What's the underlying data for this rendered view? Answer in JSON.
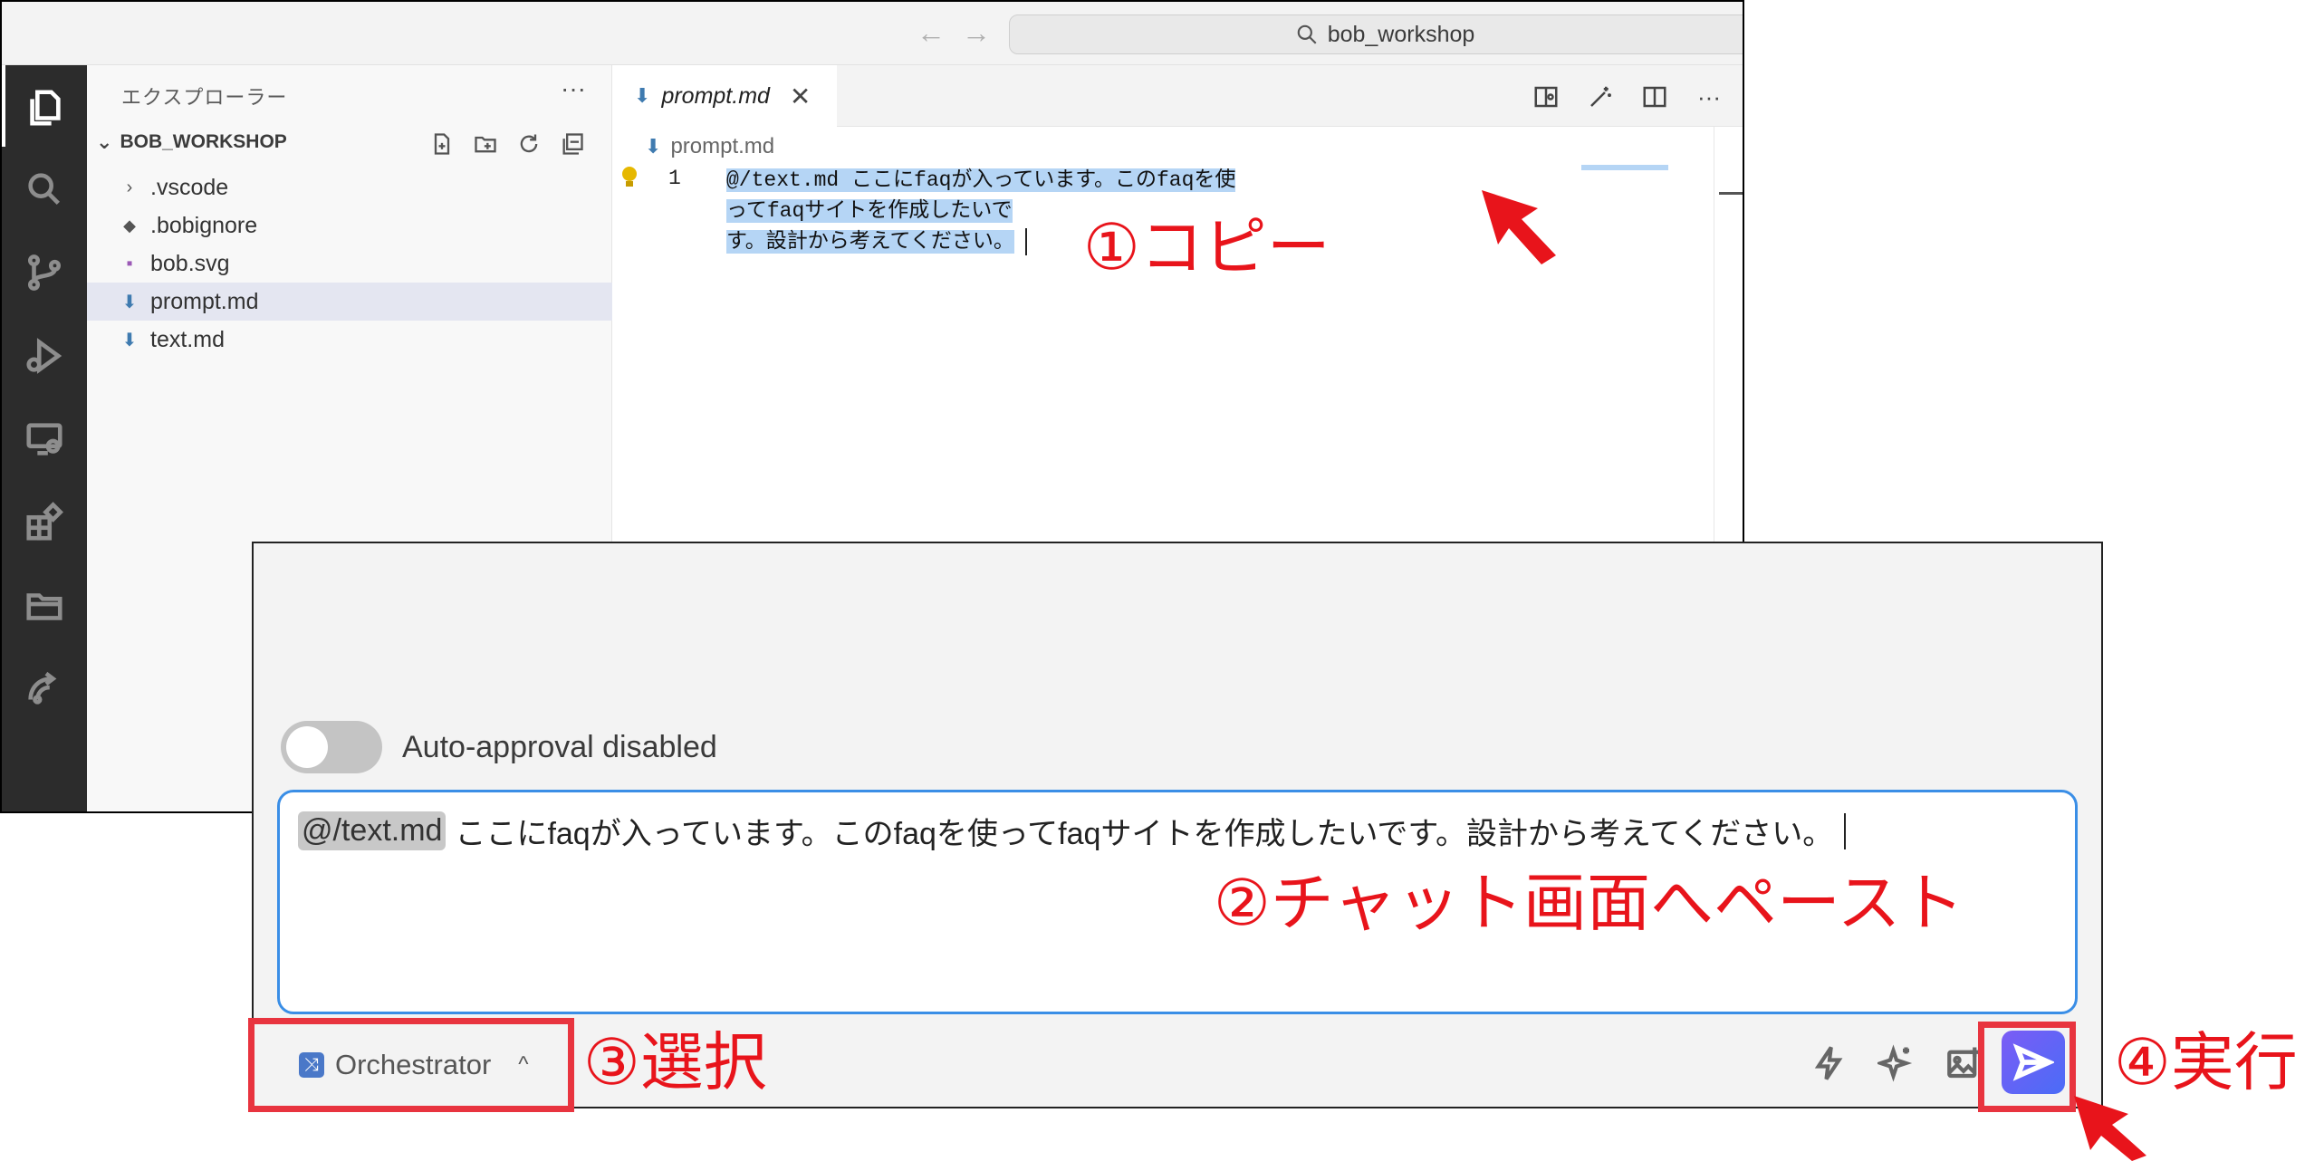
{
  "titlebar": {
    "search_text": "bob_workshop",
    "back_icon": "←",
    "forward_icon": "→"
  },
  "activitybar": {
    "items": [
      "explorer-icon",
      "search-icon",
      "source-control-icon",
      "run-debug-icon",
      "remote-explorer-icon",
      "extensions-icon",
      "folder-icon",
      "bob-icon"
    ]
  },
  "sidebar": {
    "title": "エクスプローラー",
    "more": "···",
    "root": "BOB_WORKSHOP",
    "items": [
      {
        "label": ".vscode",
        "icon": "›"
      },
      {
        "label": ".bobignore",
        "icon": "◆"
      },
      {
        "label": "bob.svg",
        "icon": "▪"
      },
      {
        "label": "prompt.md",
        "icon": "⬇"
      },
      {
        "label": "text.md",
        "icon": "⬇"
      }
    ]
  },
  "editor": {
    "tab_label": "prompt.md",
    "tab_close": "✕",
    "more": "···",
    "breadcrumb": "prompt.md",
    "line_number": "1",
    "code_line1": "@/text.md ここにfaqが入っています。このfaqを使ってfaqサイトを作成したいで",
    "code_line2": "す。設計から考えてください。"
  },
  "chat": {
    "toggle_label": "Auto-approval disabled",
    "mention": "@/text.md",
    "message": "ここにfaqが入っています。このfaqを使ってfaqサイトを作成したいです。設計から考えてください。",
    "mode_label": "Orchestrator",
    "mode_icon": "⤨",
    "mode_caret": "^"
  },
  "annotations": {
    "step1": "①コピー",
    "step2": "②チャット画面へペースト",
    "step3": "③選択",
    "step4": "④実行"
  },
  "colors": {
    "annotation": "#e8141b",
    "selection": "#b5d5f5",
    "send_button": "#5b63f6"
  }
}
